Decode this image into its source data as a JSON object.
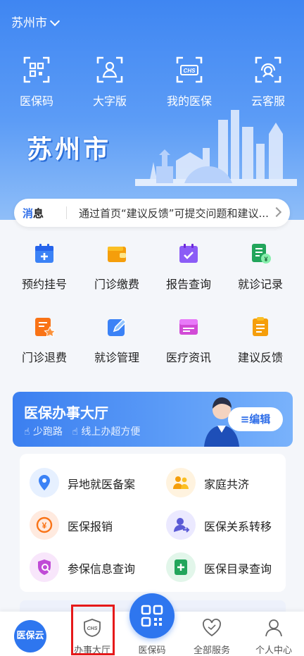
{
  "header": {
    "city": "苏州市"
  },
  "quick_actions": [
    {
      "label": "医保码",
      "icon": "qr-code-icon"
    },
    {
      "label": "大字版",
      "icon": "large-text-icon"
    },
    {
      "label": "我的医保",
      "icon": "chs-card-icon"
    },
    {
      "label": "云客服",
      "icon": "customer-service-icon"
    }
  ],
  "banner": {
    "title": "苏州市"
  },
  "notice": {
    "tag_part1": "消",
    "tag_part2": "息",
    "message": "通过首页“建议反馈”可提交问题和建议..."
  },
  "grid": [
    {
      "label": "预约挂号",
      "icon": "calendar-plus-icon",
      "color": "#3b82f6"
    },
    {
      "label": "门诊缴费",
      "icon": "wallet-icon",
      "color": "#f59e0b"
    },
    {
      "label": "报告查询",
      "icon": "report-check-icon",
      "color": "#8b5cf6"
    },
    {
      "label": "就诊记录",
      "icon": "record-yen-icon",
      "color": "#22a55b"
    },
    {
      "label": "门诊退费",
      "icon": "refund-star-icon",
      "color": "#f97316"
    },
    {
      "label": "就诊管理",
      "icon": "edit-document-icon",
      "color": "#3b82f6"
    },
    {
      "label": "医疗资讯",
      "icon": "news-icon",
      "color": "#d14bd6"
    },
    {
      "label": "建议反馈",
      "icon": "feedback-icon",
      "color": "#f59e0b"
    }
  ],
  "hall": {
    "title": "医保办事大厅",
    "tag1": "少跑路",
    "tag2": "线上办超方便",
    "edit_label": "≡编辑"
  },
  "services": [
    {
      "label": "异地就医备案",
      "icon": "location-pin-icon",
      "color": "#3b82f6",
      "bg": "#e6f0ff"
    },
    {
      "label": "家庭共济",
      "icon": "family-icon",
      "color": "#f59e0b",
      "bg": "#fff3df"
    },
    {
      "label": "医保报销",
      "icon": "yen-refresh-icon",
      "color": "#f97316",
      "bg": "#ffeadf"
    },
    {
      "label": "医保关系转移",
      "icon": "user-transfer-icon",
      "color": "#5b5bd6",
      "bg": "#ebe9ff"
    },
    {
      "label": "参保信息查询",
      "icon": "shield-search-icon",
      "color": "#c04bd6",
      "bg": "#f8e6fb"
    },
    {
      "label": "医保目录查询",
      "icon": "catalog-icon",
      "color": "#22a55b",
      "bg": "#e2f6ea"
    }
  ],
  "tabbar": {
    "home": "医保云",
    "hall": "办事大厅",
    "code": "医保码",
    "all": "全部服务",
    "me": "个人中心"
  }
}
